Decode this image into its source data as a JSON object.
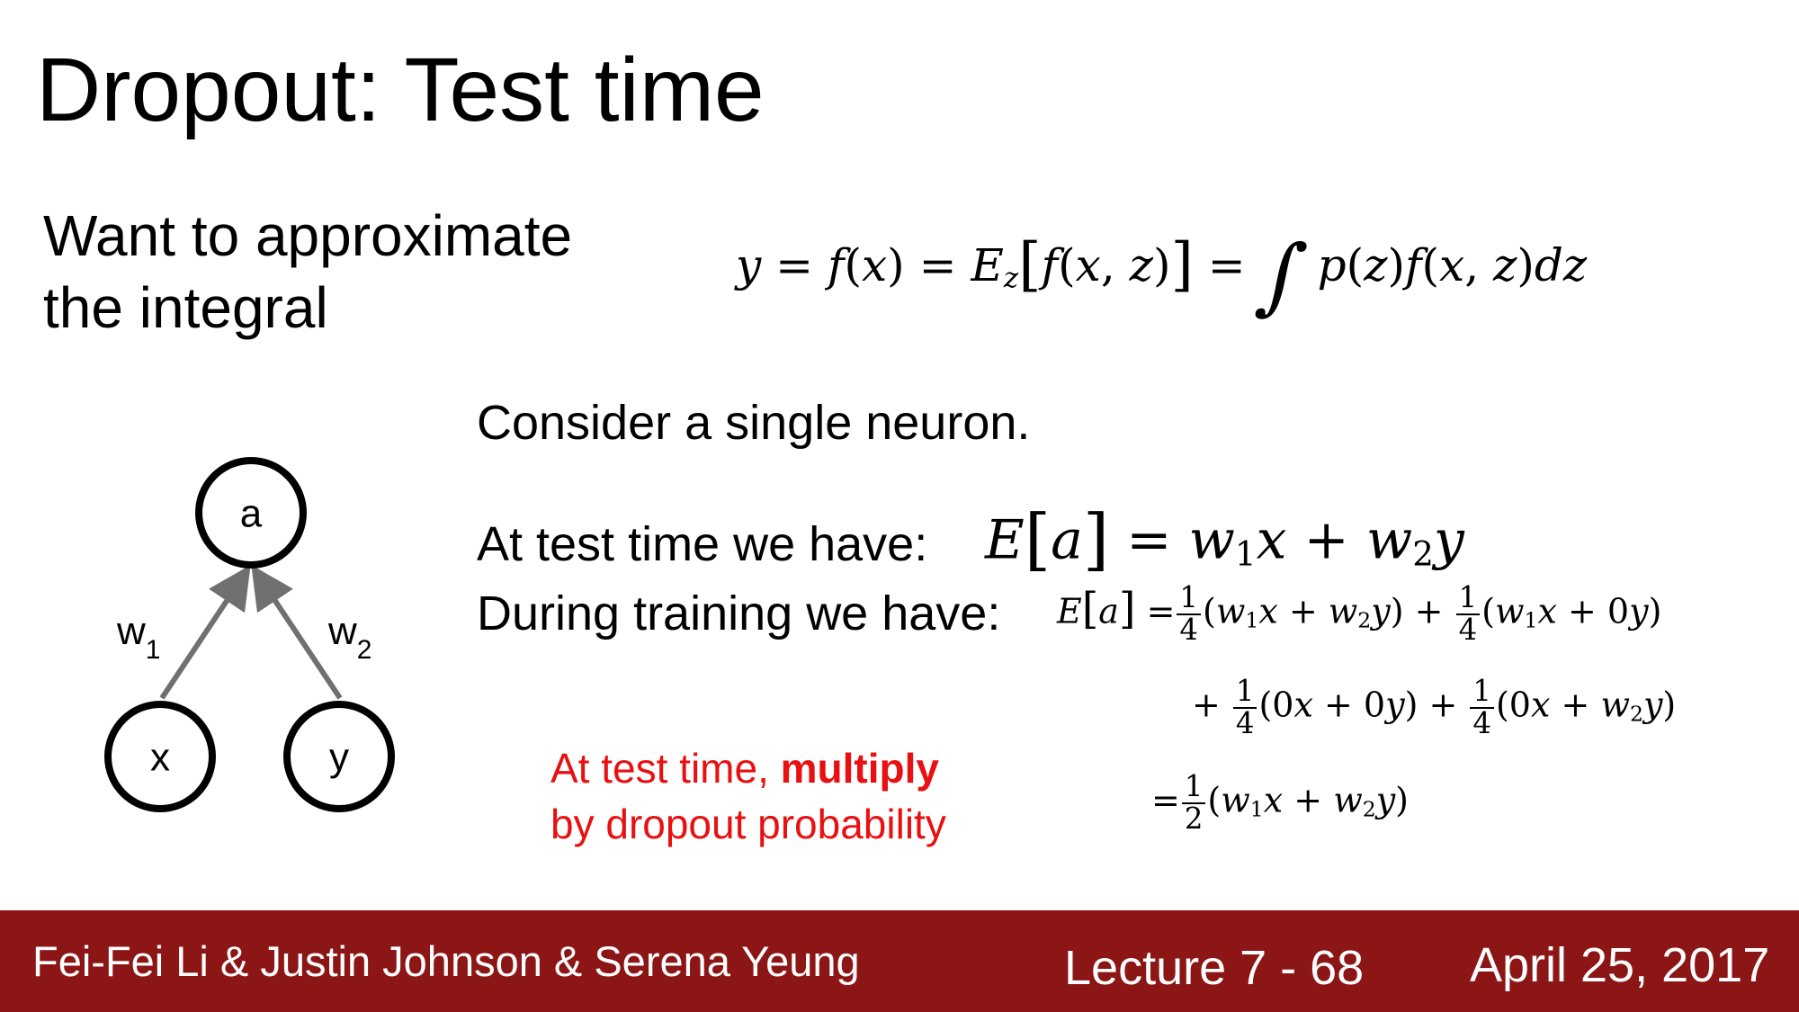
{
  "slide": {
    "title": "Dropout: Test time",
    "approx_line1": "Want to approximate",
    "approx_line2": "the integral",
    "consider": "Consider a single neuron.",
    "test_label": "At test time we have:",
    "train_label": "During training we have:",
    "note_pre": "At test time, ",
    "note_bold": "multiply",
    "note_line2": "by dropout probability"
  },
  "diagram": {
    "node_a": "a",
    "node_x": "x",
    "node_y": "y",
    "w1_base": "w",
    "w1_sub": "1",
    "w2_base": "w",
    "w2_sub": "2",
    "node_color": "#000000",
    "arrow_color": "#707070"
  },
  "math": {
    "one": "1",
    "four": "4",
    "two": "2"
  },
  "footer": {
    "authors": "Fei-Fei Li & Justin Johnson & Serena Yeung",
    "lecture": "Lecture 7 - 68",
    "date": "April 25, 2017",
    "bg_color": "#8c1515"
  }
}
